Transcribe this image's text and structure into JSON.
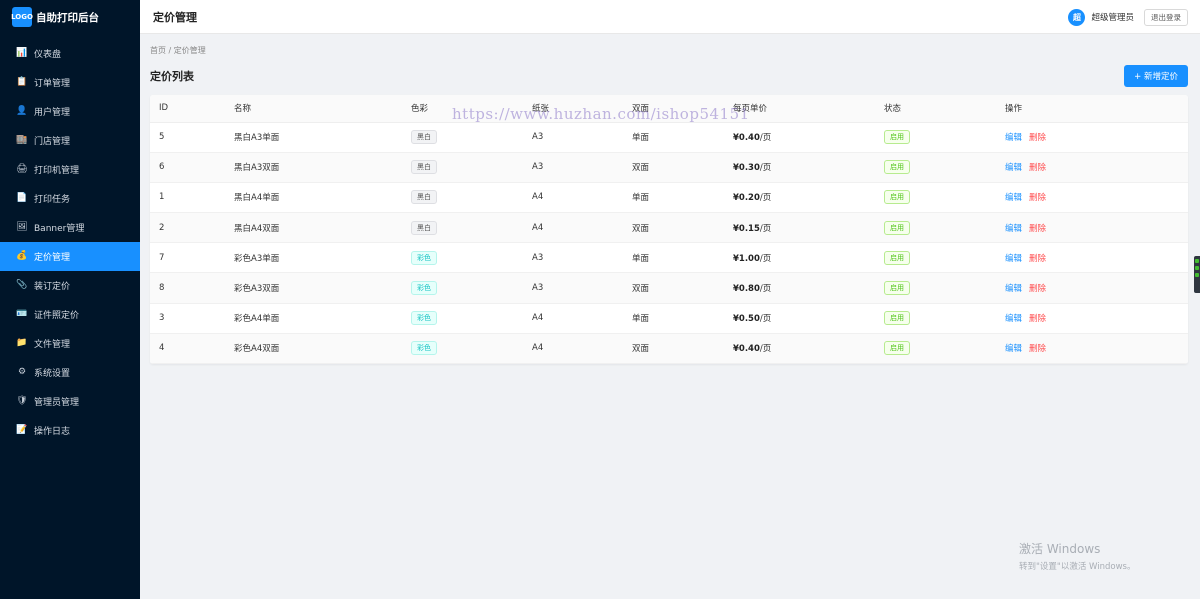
{
  "brand": {
    "logo": "LOGO",
    "title": "自助打印后台"
  },
  "sidebar": {
    "items": [
      {
        "label": "仪表盘",
        "icon": "📊",
        "icon_name": "dashboard-icon"
      },
      {
        "label": "订单管理",
        "icon": "📋",
        "icon_name": "order-icon"
      },
      {
        "label": "用户管理",
        "icon": "👤",
        "icon_name": "user-icon"
      },
      {
        "label": "门店管理",
        "icon": "🏬",
        "icon_name": "store-icon"
      },
      {
        "label": "打印机管理",
        "icon": "🖨",
        "icon_name": "printer-icon"
      },
      {
        "label": "打印任务",
        "icon": "📄",
        "icon_name": "print-task-icon"
      },
      {
        "label": "Banner管理",
        "icon": "🖼",
        "icon_name": "banner-icon"
      },
      {
        "label": "定价管理",
        "icon": "💰",
        "icon_name": "money-bag-icon",
        "active": true
      },
      {
        "label": "装订定价",
        "icon": "📎",
        "icon_name": "binding-icon"
      },
      {
        "label": "证件照定价",
        "icon": "🪪",
        "icon_name": "id-photo-icon"
      },
      {
        "label": "文件管理",
        "icon": "📁",
        "icon_name": "folder-icon"
      },
      {
        "label": "系统设置",
        "icon": "⚙",
        "icon_name": "gear-icon"
      },
      {
        "label": "管理员管理",
        "icon": "🛡",
        "icon_name": "shield-icon"
      },
      {
        "label": "操作日志",
        "icon": "📝",
        "icon_name": "log-icon"
      }
    ]
  },
  "header": {
    "title": "定价管理",
    "avatar_text": "超",
    "user_name": "超级管理员",
    "logout_label": "退出登录"
  },
  "breadcrumb": "首页 / 定价管理",
  "page": {
    "heading": "定价列表",
    "add_button": "+ 新增定价"
  },
  "table": {
    "columns": [
      "ID",
      "名称",
      "色彩",
      "纸张",
      "双面",
      "每页单价",
      "状态",
      "操作"
    ],
    "rows": [
      {
        "id": "5",
        "name": "黑白A3单面",
        "color": "黑白",
        "color_type": "bw",
        "paper": "A3",
        "duplex": "单面",
        "price": "¥0.40",
        "unit": "/页",
        "status": "启用",
        "edit": "编辑",
        "delete": "删除"
      },
      {
        "id": "6",
        "name": "黑白A3双面",
        "color": "黑白",
        "color_type": "bw",
        "paper": "A3",
        "duplex": "双面",
        "price": "¥0.30",
        "unit": "/页",
        "status": "启用",
        "edit": "编辑",
        "delete": "删除"
      },
      {
        "id": "1",
        "name": "黑白A4单面",
        "color": "黑白",
        "color_type": "bw",
        "paper": "A4",
        "duplex": "单面",
        "price": "¥0.20",
        "unit": "/页",
        "status": "启用",
        "edit": "编辑",
        "delete": "删除"
      },
      {
        "id": "2",
        "name": "黑白A4双面",
        "color": "黑白",
        "color_type": "bw",
        "paper": "A4",
        "duplex": "双面",
        "price": "¥0.15",
        "unit": "/页",
        "status": "启用",
        "edit": "编辑",
        "delete": "删除"
      },
      {
        "id": "7",
        "name": "彩色A3单面",
        "color": "彩色",
        "color_type": "color",
        "paper": "A3",
        "duplex": "单面",
        "price": "¥1.00",
        "unit": "/页",
        "status": "启用",
        "edit": "编辑",
        "delete": "删除"
      },
      {
        "id": "8",
        "name": "彩色A3双面",
        "color": "彩色",
        "color_type": "color",
        "paper": "A3",
        "duplex": "双面",
        "price": "¥0.80",
        "unit": "/页",
        "status": "启用",
        "edit": "编辑",
        "delete": "删除"
      },
      {
        "id": "3",
        "name": "彩色A4单面",
        "color": "彩色",
        "color_type": "color",
        "paper": "A4",
        "duplex": "单面",
        "price": "¥0.50",
        "unit": "/页",
        "status": "启用",
        "edit": "编辑",
        "delete": "删除"
      },
      {
        "id": "4",
        "name": "彩色A4双面",
        "color": "彩色",
        "color_type": "color",
        "paper": "A4",
        "duplex": "双面",
        "price": "¥0.40",
        "unit": "/页",
        "status": "启用",
        "edit": "编辑",
        "delete": "删除"
      }
    ]
  },
  "watermark": "https://www.huzhan.com/ishop54151",
  "windows_activation": {
    "line1": "激活 Windows",
    "line2": "转到\"设置\"以激活 Windows。"
  },
  "colors": {
    "sidebar_bg": "#001529",
    "accent": "#1890ff",
    "danger": "#ff4d4f",
    "success": "#52c41a",
    "teal": "#13c2c2"
  }
}
